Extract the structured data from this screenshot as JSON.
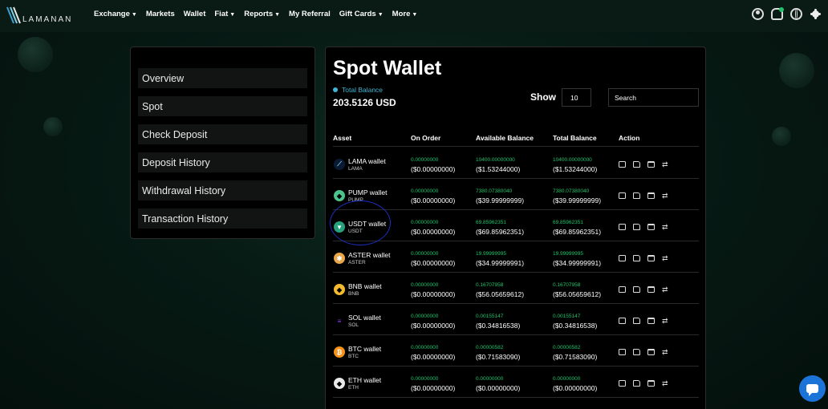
{
  "brand": {
    "name": "LAMANAN",
    "logo_icon": "lamanan-logo-icon"
  },
  "nav": {
    "links": [
      {
        "label": "Exchange",
        "dropdown": true
      },
      {
        "label": "Markets",
        "dropdown": false
      },
      {
        "label": "Wallet",
        "dropdown": false
      },
      {
        "label": "Fiat",
        "dropdown": true
      },
      {
        "label": "Reports",
        "dropdown": true
      },
      {
        "label": "My Referral",
        "dropdown": false
      },
      {
        "label": "Gift Cards",
        "dropdown": true
      },
      {
        "label": "More",
        "dropdown": true
      }
    ],
    "icons": [
      "user-icon",
      "bell-icon",
      "globe-icon",
      "sun-icon"
    ]
  },
  "sidebar": {
    "items": [
      {
        "label": "Overview"
      },
      {
        "label": "Spot"
      },
      {
        "label": "Check Deposit"
      },
      {
        "label": "Deposit History"
      },
      {
        "label": "Withdrawal History"
      },
      {
        "label": "Transaction History"
      }
    ]
  },
  "wallet": {
    "title": "Spot Wallet",
    "total_balance_label": "Total Balance",
    "total_balance_value": "203.5126 USD",
    "show_label": "Show",
    "show_value": "10",
    "search_placeholder": "Search",
    "columns": [
      "Asset",
      "On Order",
      "Available Balance",
      "Total Balance",
      "Action"
    ],
    "rows": [
      {
        "name": "LAMA wallet",
        "symbol": "LAMA",
        "icon": "lama-coin-icon",
        "color": "#0b1a33",
        "order": "0.00000000",
        "order_usd": "($0.00000000)",
        "avail": "10400.00000000",
        "avail_usd": "($1.53244000)",
        "total": "10400.00000000",
        "total_usd": "($1.53244000)"
      },
      {
        "name": "PUMP wallet",
        "symbol": "PUMP",
        "icon": "pump-coin-icon",
        "color": "#4cc38a",
        "order": "0.00000000",
        "order_usd": "($0.00000000)",
        "avail": "7380.07380040",
        "avail_usd": "($39.99999999)",
        "total": "7380.07380040",
        "total_usd": "($39.99999999)"
      },
      {
        "name": "USDT wallet",
        "symbol": "USDT",
        "icon": "usdt-coin-icon",
        "color": "#26a17b",
        "order": "0.00000000",
        "order_usd": "($0.00000000)",
        "avail": "69.85962351",
        "avail_usd": "($69.85962351)",
        "total": "69.85962351",
        "total_usd": "($69.85962351)"
      },
      {
        "name": "ASTER wallet",
        "symbol": "ASTER",
        "icon": "aster-coin-icon",
        "color": "#e9a74b",
        "order": "0.00000000",
        "order_usd": "($0.00000000)",
        "avail": "19.99999995",
        "avail_usd": "($34.99999991)",
        "total": "19.99999995",
        "total_usd": "($34.99999991)"
      },
      {
        "name": "BNB wallet",
        "symbol": "BNB",
        "icon": "bnb-coin-icon",
        "color": "#f3ba2f",
        "order": "0.00000000",
        "order_usd": "($0.00000000)",
        "avail": "0.16707958",
        "avail_usd": "($56.05659612)",
        "total": "0.16707958",
        "total_usd": "($56.05659612)"
      },
      {
        "name": "SOL wallet",
        "symbol": "SOL",
        "icon": "sol-coin-icon",
        "color": "#000000",
        "order": "0.00000000",
        "order_usd": "($0.00000000)",
        "avail": "0.00155147",
        "avail_usd": "($0.34816538)",
        "total": "0.00155147",
        "total_usd": "($0.34816538)"
      },
      {
        "name": "BTC wallet",
        "symbol": "BTC",
        "icon": "btc-coin-icon",
        "color": "#f7931a",
        "order": "0.00000000",
        "order_usd": "($0.00000000)",
        "avail": "0.00000582",
        "avail_usd": "($0.71583090)",
        "total": "0.00000582",
        "total_usd": "($0.71583090)"
      },
      {
        "name": "ETH wallet",
        "symbol": "ETH",
        "icon": "eth-coin-icon",
        "color": "#e8e8e8",
        "order": "0.00000000",
        "order_usd": "($0.00000000)",
        "avail": "0.00000000",
        "avail_usd": "($0.00000000)",
        "total": "0.00000000",
        "total_usd": "($0.00000000)"
      }
    ],
    "action_icons": [
      "deposit-icon",
      "withdraw-wallet-icon",
      "transfer-icon",
      "swap-icon"
    ]
  }
}
